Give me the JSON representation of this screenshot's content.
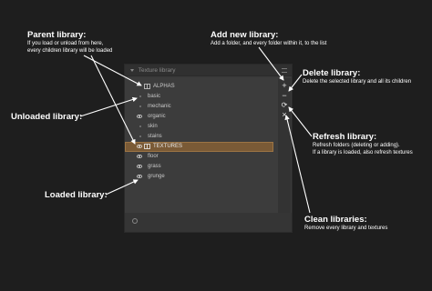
{
  "panel": {
    "title": "Texture library",
    "tree": [
      {
        "label": "ALPHAS",
        "type": "library",
        "loaded": false,
        "depth": 0
      },
      {
        "label": "basic",
        "type": "folder",
        "depth": 1
      },
      {
        "label": "mechanic",
        "type": "folder",
        "depth": 1
      },
      {
        "label": "organic",
        "type": "folder",
        "loaded": true,
        "depth": 1
      },
      {
        "label": "skin",
        "type": "folder",
        "depth": 1
      },
      {
        "label": "stains",
        "type": "folder",
        "depth": 1
      },
      {
        "label": "TEXTURES",
        "type": "library",
        "loaded": true,
        "selected": true,
        "depth": 0
      },
      {
        "label": "floor",
        "type": "folder",
        "loaded": true,
        "depth": 1
      },
      {
        "label": "grass",
        "type": "folder",
        "loaded": true,
        "depth": 1
      },
      {
        "label": "grunge",
        "type": "folder",
        "loaded": true,
        "depth": 1
      }
    ],
    "buttons": {
      "add": "+",
      "delete": "−",
      "refresh": "⟳",
      "clean": "×"
    }
  },
  "annotations": {
    "parent_library": {
      "title": "Parent library:",
      "desc1": "If you load or unload from here,",
      "desc2": "every children library will be loaded"
    },
    "unloaded_library": {
      "title": "Unloaded library:"
    },
    "loaded_library": {
      "title": "Loaded library:"
    },
    "add_new_library": {
      "title": "Add new library:",
      "desc1": "Add a folder, and every folder within it, to the list"
    },
    "delete_library": {
      "title": "Delete library:",
      "desc1": "Delete the selected library and all its children"
    },
    "refresh_library": {
      "title": "Refresh library:",
      "desc1": "Refresh folders (deleting or adding).",
      "desc2": "If a library is loaded, also refresh textures"
    },
    "clean_libraries": {
      "title": "Clean libraries:",
      "desc1": "Remove every library and textures"
    }
  },
  "colors": {
    "background": "#1e1e1e",
    "panel": "#3a3a3a",
    "selection": "#7a5a36",
    "annotation_text": "#ffffff"
  }
}
